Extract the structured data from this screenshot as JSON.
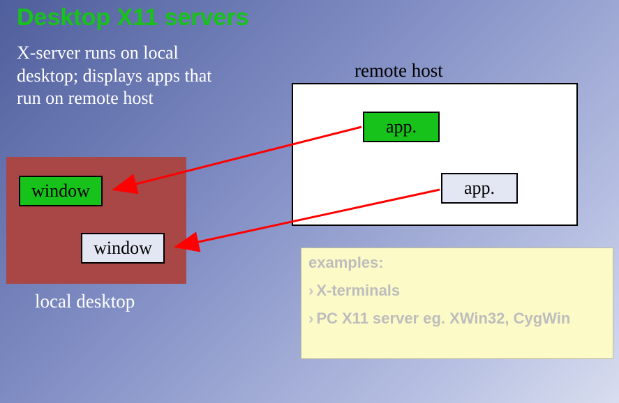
{
  "title": "Desktop X11 servers",
  "description": "X-server runs on local desktop; displays apps that run on remote host",
  "remote": {
    "label": "remote host",
    "app1": "app.",
    "app2": "app."
  },
  "local": {
    "label": "local desktop",
    "window1": "window",
    "window2": "window"
  },
  "examples": {
    "heading": "examples:",
    "items": [
      "X-terminals",
      "PC X11 server eg. XWin32, CygWin"
    ]
  },
  "colors": {
    "accent_green": "#17c21a",
    "panel_red": "#a94747",
    "panel_yellow": "#fcfac7",
    "arrow": "#ff0000"
  }
}
